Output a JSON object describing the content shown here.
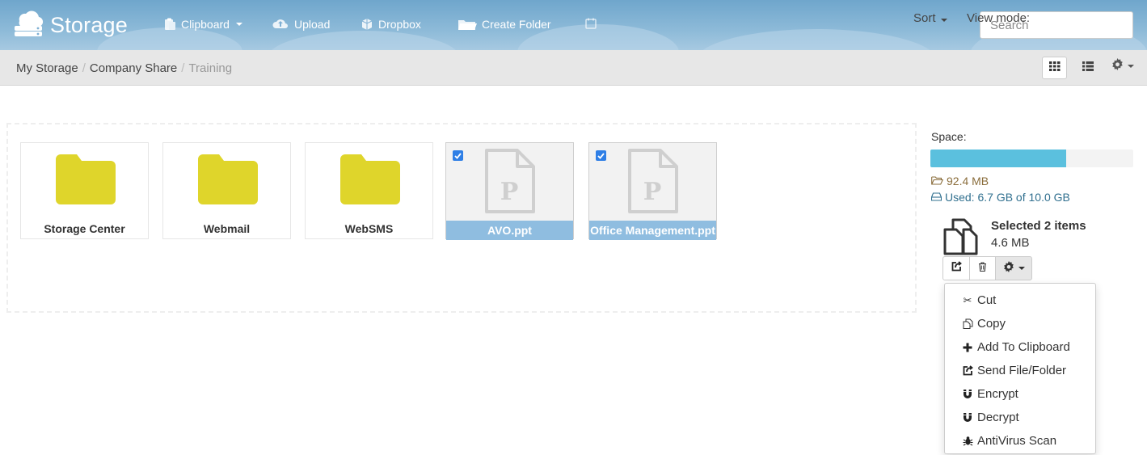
{
  "app": {
    "title": "Storage"
  },
  "nav": {
    "clipboard": "Clipboard",
    "upload": "Upload",
    "dropbox": "Dropbox",
    "create_folder": "Create Folder"
  },
  "search": {
    "placeholder": "Search",
    "value": ""
  },
  "breadcrumb": {
    "items": [
      "My Storage",
      "Company Share"
    ],
    "current": "Training"
  },
  "toolbar": {
    "sort_label": "Sort",
    "view_mode_label": "View mode:",
    "view_mode_active": "grid"
  },
  "files": [
    {
      "name": "Storage Center",
      "type": "folder",
      "selected": false
    },
    {
      "name": "Webmail",
      "type": "folder",
      "selected": false
    },
    {
      "name": "WebSMS",
      "type": "folder",
      "selected": false
    },
    {
      "name": "AVO.ppt",
      "type": "ppt",
      "selected": true
    },
    {
      "name": "Office Management.ppt",
      "type": "ppt",
      "selected": true
    }
  ],
  "space": {
    "label": "Space:",
    "folder_size": "92.4 MB",
    "used_text": "Used: 6.7 GB of 10.0 GB",
    "used_fraction": 0.67
  },
  "selection": {
    "title": "Selected 2 items",
    "size": "4.6 MB"
  },
  "menu": {
    "items": [
      {
        "label": "Cut",
        "icon": "scissors-icon"
      },
      {
        "label": "Copy",
        "icon": "copy-icon"
      },
      {
        "label": "Add To Clipboard",
        "icon": "plus-icon"
      },
      {
        "label": "Send File/Folder",
        "icon": "share-icon"
      },
      {
        "label": "Encrypt",
        "icon": "magnet-icon"
      },
      {
        "label": "Decrypt",
        "icon": "magnet-icon"
      },
      {
        "label": "AntiVirus Scan",
        "icon": "bug-icon"
      }
    ]
  },
  "colors": {
    "topbar": "#7fb0d4",
    "folder": "#dfd52b",
    "selected_label": "#8fbde0",
    "space_bar": "#5bc0de",
    "warning_text": "#8a6d3b",
    "info_text": "#31708f"
  }
}
